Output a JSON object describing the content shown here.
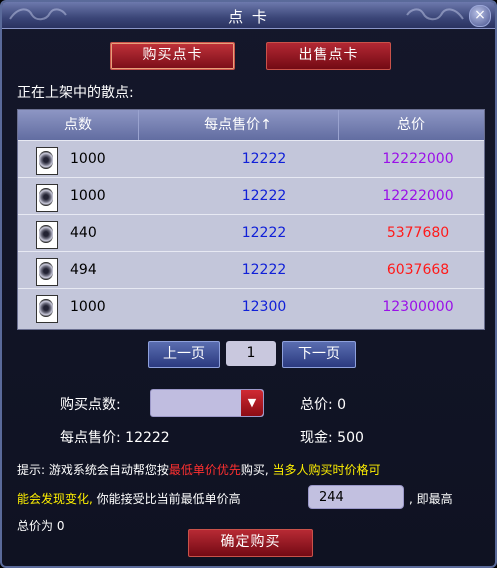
{
  "window": {
    "title": "点 卡",
    "close_label": "×"
  },
  "tabs": [
    {
      "label": "购买点卡",
      "active": true
    },
    {
      "label": "出售点卡",
      "active": false
    }
  ],
  "listing_heading": "正在上架中的散点:",
  "table": {
    "columns": [
      "点数",
      "每点售价↑",
      "总价"
    ],
    "rows": [
      {
        "points": "1000",
        "unit_price": "12222",
        "total": "12222000",
        "total_color": "#9a10e8"
      },
      {
        "points": "1000",
        "unit_price": "12222",
        "total": "12222000",
        "total_color": "#9a10e8"
      },
      {
        "points": "440",
        "unit_price": "12222",
        "total": "5377680",
        "total_color": "#ff1a1a"
      },
      {
        "points": "494",
        "unit_price": "12222",
        "total": "6037668",
        "total_color": "#ff1a1a"
      },
      {
        "points": "1000",
        "unit_price": "12300",
        "total": "12300000",
        "total_color": "#9a10e8"
      }
    ]
  },
  "pager": {
    "prev_label": "上一页",
    "page": "1",
    "next_label": "下一页"
  },
  "purchase": {
    "points_label": "购买点数:",
    "points_value": "",
    "total_label": "总价: 0",
    "unit_price_label": "每点售价: 12222",
    "cash_label": "现金: 500"
  },
  "hint": {
    "line1_a": "提示: 游戏系统会自动帮您按",
    "line1_red": "最低单价优先",
    "line1_b": "购买, ",
    "line1_yellow": "当多人购买时价格可",
    "line2_yellow": "能会发现变化,",
    "line2_b": " 你能接受比当前最低单价高",
    "input_value": "244",
    "line2_c": ",  即最高",
    "line3": "总价为 0"
  },
  "confirm_label": "确定购买"
}
